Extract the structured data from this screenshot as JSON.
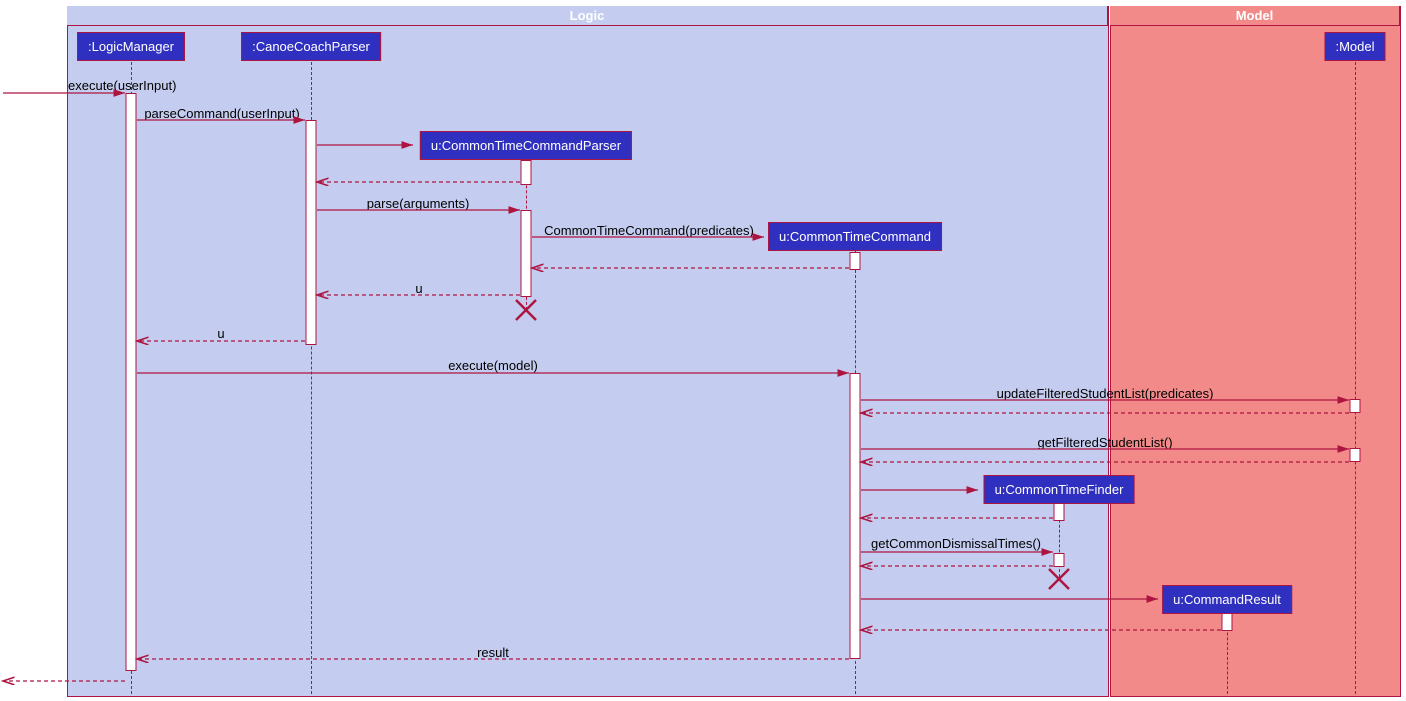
{
  "frames": {
    "logic": "Logic",
    "model": "Model"
  },
  "participants": {
    "logicManager": ":LogicManager",
    "canoeCoachParser": ":CanoeCoachParser",
    "commonTimeCommandParser": "u:CommonTimeCommandParser",
    "commonTimeCommand": "u:CommonTimeCommand",
    "model": ":Model",
    "commonTimeFinder": "u:CommonTimeFinder",
    "commandResult": "u:CommandResult"
  },
  "messages": {
    "executeUserInput": "execute(userInput)",
    "parseCommandUserInput": "parseCommand(userInput)",
    "parseArguments": "parse(arguments)",
    "commonTimeCommandPredicates": "CommonTimeCommand(predicates)",
    "u1": "u",
    "u2": "u",
    "executeModel": "execute(model)",
    "updateFilteredStudentList": "updateFilteredStudentList(predicates)",
    "getFilteredStudentList": "getFilteredStudentList()",
    "getCommonDismissalTimes": "getCommonDismissalTimes()",
    "result": "result"
  }
}
